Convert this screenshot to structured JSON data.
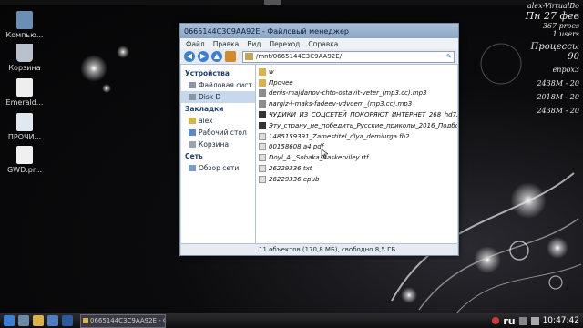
{
  "desktop": {
    "icons": [
      {
        "label": "Компью..."
      },
      {
        "label": "Корзина"
      },
      {
        "label": "Emerald..."
      },
      {
        "label": "ПРОЧИ..."
      },
      {
        "label": "GWD.pr..."
      }
    ]
  },
  "conky": {
    "user": "alex-VirtualBo",
    "date": "Пн 27 фев",
    "procs": "367 procs",
    "users": "1 users",
    "processes_label": "Процессы",
    "processes_value": "90",
    "cpu_label": "епрох3",
    "cpu_value1": "2438M - 20",
    "cpu_value2": "2018M - 20",
    "cpu_value3": "2438M - 20"
  },
  "window": {
    "title": "0665144C3C9AA92E - Файловый менеджер",
    "menu": [
      "Файл",
      "Правка",
      "Вид",
      "Переход",
      "Справка"
    ],
    "location": "/mnt/0665144C3C9AA92E/",
    "sidebar": {
      "devices_label": "Устройства",
      "devices": [
        "Файловая сист...",
        "Disk D"
      ],
      "bookmarks_label": "Закладки",
      "bookmarks": [
        "alex",
        "Рабочий стол",
        "Корзина"
      ],
      "network_label": "Сеть",
      "network": [
        "Обзор сети"
      ]
    },
    "files": [
      {
        "name": "w",
        "type": "folder"
      },
      {
        "name": "Прочее",
        "type": "folder"
      },
      {
        "name": "denis-majdanov-chto-ostavit-veter_(mp3.cc).mp3",
        "type": "audio"
      },
      {
        "name": "nargiz-i-maks-fadeev-vdvoem_(mp3.cc).mp3",
        "type": "audio"
      },
      {
        "name": "ЧУДИКИ_ИЗ_СОЦСЕТЕЙ_ПОКОРЯЮТ_ИНТЕРНЕТ_268_hd720.m",
        "type": "video"
      },
      {
        "name": "Эту_страну_не_победить_Русские_приколы_2016_Подборка_п",
        "type": "video"
      },
      {
        "name": "1485159391_Zamestitel_dlya_demiurga.fb2",
        "type": "doc"
      },
      {
        "name": "00158608.a4.pdf",
        "type": "pdf"
      },
      {
        "name": "Doyl_A._Sobaka_Baskerviley.rtf",
        "type": "doc"
      },
      {
        "name": "26229336.txt",
        "type": "doc"
      },
      {
        "name": "26229336.epub",
        "type": "doc"
      }
    ],
    "status": "11 объектов (170,8 МБ), свободно 8,5 ГБ"
  },
  "taskbar": {
    "task_label": "0665144C3C9AA92E - Ф",
    "lang": "ru",
    "time": "10:47:42"
  }
}
